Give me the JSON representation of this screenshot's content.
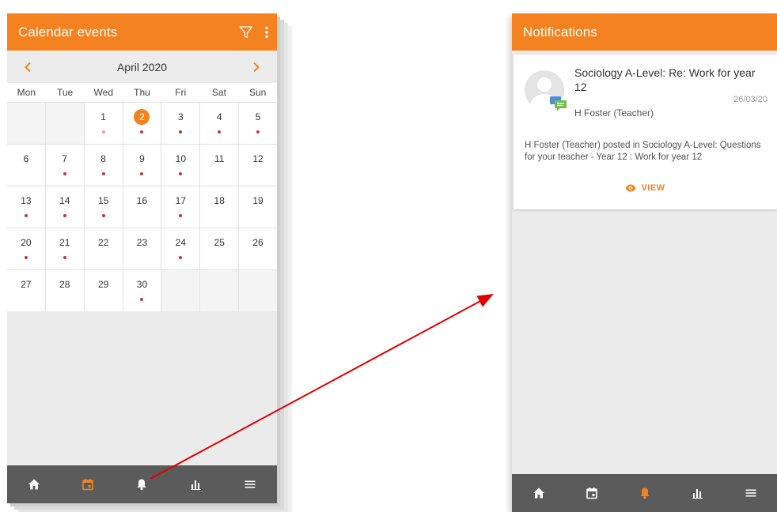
{
  "calendar_screen": {
    "title": "Calendar events",
    "month": "April 2020",
    "weekdays": [
      "Mon",
      "Tue",
      "Wed",
      "Thu",
      "Fri",
      "Sat",
      "Sun"
    ],
    "days": [
      {
        "day": ""
      },
      {
        "day": ""
      },
      {
        "day": "1",
        "dot": "faint"
      },
      {
        "day": "2",
        "dot": "yes",
        "today": true
      },
      {
        "day": "3",
        "dot": "yes"
      },
      {
        "day": "4",
        "dot": "yes"
      },
      {
        "day": "5",
        "dot": "yes"
      },
      {
        "day": "6"
      },
      {
        "day": "7",
        "dot": "yes"
      },
      {
        "day": "8",
        "dot": "yes"
      },
      {
        "day": "9",
        "dot": "yes"
      },
      {
        "day": "10",
        "dot": "yes"
      },
      {
        "day": "11"
      },
      {
        "day": "12"
      },
      {
        "day": "13",
        "dot": "yes"
      },
      {
        "day": "14",
        "dot": "yes"
      },
      {
        "day": "15",
        "dot": "yes"
      },
      {
        "day": "16"
      },
      {
        "day": "17",
        "dot": "yes"
      },
      {
        "day": "18"
      },
      {
        "day": "19"
      },
      {
        "day": "20",
        "dot": "yes"
      },
      {
        "day": "21",
        "dot": "yes"
      },
      {
        "day": "22"
      },
      {
        "day": "23"
      },
      {
        "day": "24",
        "dot": "yes"
      },
      {
        "day": "25"
      },
      {
        "day": "26"
      },
      {
        "day": "27"
      },
      {
        "day": "28"
      },
      {
        "day": "29"
      },
      {
        "day": "30",
        "dot": "yes"
      },
      {
        "day": ""
      },
      {
        "day": ""
      },
      {
        "day": ""
      }
    ],
    "active_tab": "calendar"
  },
  "notifications_screen": {
    "title": "Notifications",
    "notification": {
      "subject": "Sociology A-Level: Re: Work for year 12",
      "date": "26/03/20",
      "author": "H Foster (Teacher)",
      "message": "H Foster (Teacher) posted in Sociology A-Level: Questions for your teacher - Year 12 : Work for year 12",
      "action_label": "VIEW"
    },
    "active_tab": "notifications"
  },
  "nav_tabs": [
    {
      "id": "home",
      "icon": "home-icon"
    },
    {
      "id": "calendar",
      "icon": "calendar-icon"
    },
    {
      "id": "notifications",
      "icon": "bell-icon"
    },
    {
      "id": "grades",
      "icon": "bar-chart-icon"
    },
    {
      "id": "menu",
      "icon": "menu-icon"
    }
  ],
  "colors": {
    "accent": "#f58220",
    "nav_bg": "#5b5b5b",
    "nav_icon": "#ffffff",
    "event_dot": "#c0393b",
    "arrow": "#e00000"
  }
}
